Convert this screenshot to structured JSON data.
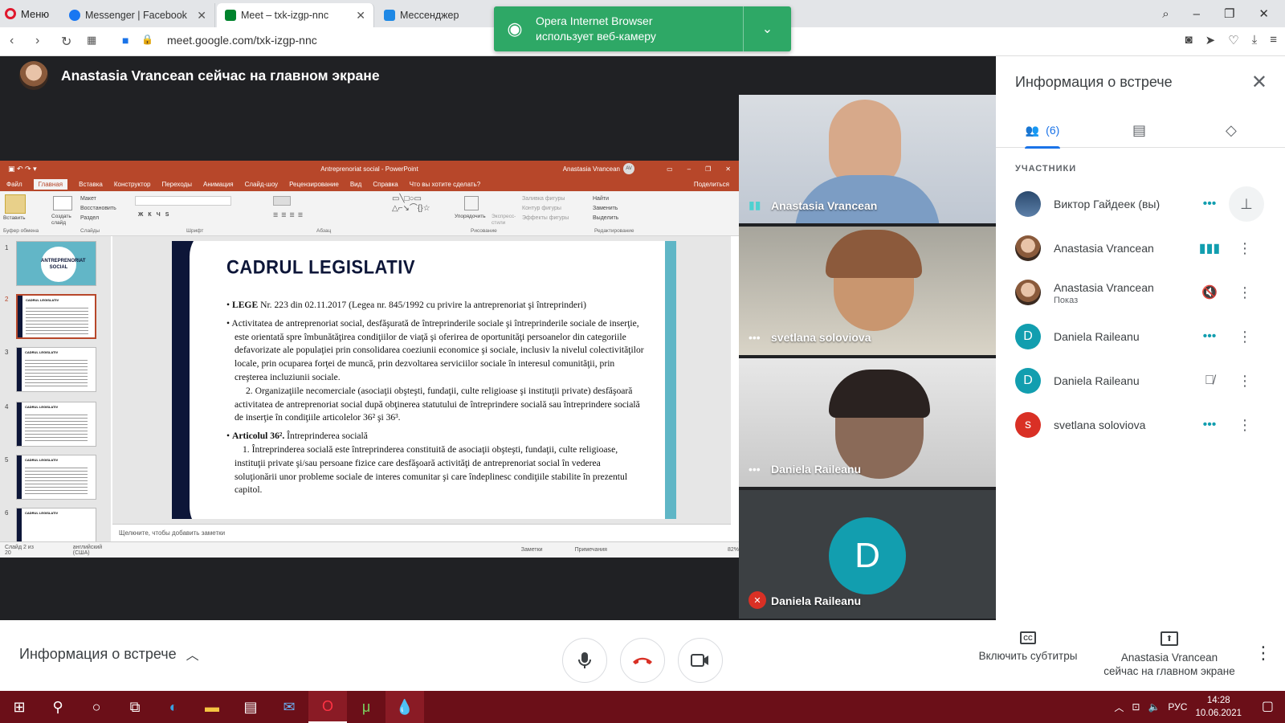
{
  "browser": {
    "menu_label": "Меню",
    "tabs": [
      {
        "label": "Messenger | Facebook"
      },
      {
        "label": "Meet – txk-izgp-nnc"
      },
      {
        "label": "Мессенджер"
      }
    ],
    "url": "meet.google.com/txk-izgp-nnc",
    "notification": {
      "line1": "Opera Internet Browser",
      "line2": "использует веб-камеру"
    }
  },
  "stage": {
    "presenter_banner": "Anastasia Vrancean сейчас на главном экране"
  },
  "ppt": {
    "title": "Antreprenoriat social  -  PowerPoint",
    "user": "Anastasia Vrancean",
    "user_initials": "AV",
    "menu": [
      "Файл",
      "Главная",
      "Вставка",
      "Конструктор",
      "Переходы",
      "Анимация",
      "Слайд-шоу",
      "Рецензирование",
      "Вид",
      "Справка",
      "Что вы хотите сделать?"
    ],
    "share": "Поделиться",
    "ribbon_groups": [
      "Буфер обмена",
      "Слайды",
      "Шрифт",
      "Абзац",
      "Рисование",
      "Редактирование"
    ],
    "ribbon_buttons": {
      "paste": "Вставить",
      "create_slide": "Создать слайд",
      "layout": "Макет",
      "restore": "Восстановить",
      "section": "Раздел",
      "arrange": "Упорядочить",
      "express": "Экспресс-стили",
      "fill": "Заливка фигуры",
      "outline": "Контур фигуры",
      "effects": "Эффекты фигуры",
      "find": "Найти",
      "replace": "Заменить",
      "select": "Выделить"
    },
    "thumb_numbers": [
      "1",
      "2",
      "3",
      "4",
      "5",
      "6"
    ],
    "thumb1_title": "ANTREPRENORIAT SOCIAL",
    "thumb_small_title": "CADRUL LEGISLATIV",
    "notes_placeholder": "Щелкните, чтобы добавить заметки",
    "status": {
      "slide": "Слайд 2 из 20",
      "lang": "английский (США)",
      "notes": "Заметки",
      "comments": "Примечания",
      "zoom": "82%"
    },
    "slide": {
      "heading": "CADRUL LEGISLATIV",
      "p1_bold": "LEGE",
      "p1_rest": " Nr. 223  din   02.11.2017 (Legea nr. 845/1992 cu privire la antreprenoriat şi întreprinderi)",
      "p2": "Activitatea de antreprenoriat social, desfăşurată de întreprinderile sociale şi întreprinderile sociale de inserţie, este orientată spre îmbunătăţirea condiţiilor de viaţă şi oferirea de oportunităţi persoanelor din categoriile defavorizate ale populaţiei prin consolidarea coeziunii economice şi sociale, inclusiv la nivelul colectivităţilor locale, prin ocuparea forţei de muncă, prin dezvoltarea serviciilor sociale în interesul comunităţii, prin creşterea incluziunii sociale.",
      "p3": "2. Organizaţiile necomerciale (asociaţii obşteşti, fundaţii, culte religioase şi instituţii private) desfăşoară activitatea de antreprenoriat social după obţinerea statutului de întreprindere socială sau întreprindere socială de inserţie în condiţiile articolelor 36² şi 36³.",
      "p4_bold": "Articolul 36².",
      "p4_rest": " Întreprinderea socială",
      "p5": "1. Întreprinderea socială este întreprinderea constituită de asociaţii obşteşti, fundaţii, culte religioase, instituţii private şi/sau persoane fizice care desfăşoară activităţi de antreprenoriat social în vederea soluţionării unor probleme sociale de interes comunitar şi care îndeplinesc condiţiile stabilite în prezentul capitol."
    }
  },
  "tiles": [
    {
      "name": "Anastasia Vrancean"
    },
    {
      "name": "svetlana soloviova"
    },
    {
      "name": "Daniela Raileanu"
    },
    {
      "name": "Daniela Raileanu",
      "initial": "D"
    }
  ],
  "panel": {
    "title": "Информация о встрече",
    "people_count": "(6)",
    "section": "УЧАСТНИКИ",
    "participants": [
      {
        "name": "Виктор Гайдеек (вы)",
        "sub": ""
      },
      {
        "name": "Anastasia Vrancean",
        "sub": ""
      },
      {
        "name": "Anastasia Vrancean",
        "sub": "Показ"
      },
      {
        "name": "Daniela Raileanu",
        "sub": "",
        "initial": "D"
      },
      {
        "name": "Daniela Raileanu",
        "sub": "",
        "initial": "D"
      },
      {
        "name": "svetlana soloviova",
        "sub": "",
        "initial": "s"
      }
    ]
  },
  "bottom": {
    "meeting_info": "Информация о встрече",
    "captions": "Включить субтитры",
    "presenting_line1": "Anastasia Vrancean",
    "presenting_line2": "сейчас на главном экране"
  },
  "taskbar": {
    "lang": "РУС",
    "time": "14:28",
    "date": "10.06.2021"
  },
  "colors": {
    "meet_teal": "#129eaf",
    "hangup_red": "#d93025",
    "ppt_red": "#b7472a",
    "taskbar": "#6b0f18"
  }
}
